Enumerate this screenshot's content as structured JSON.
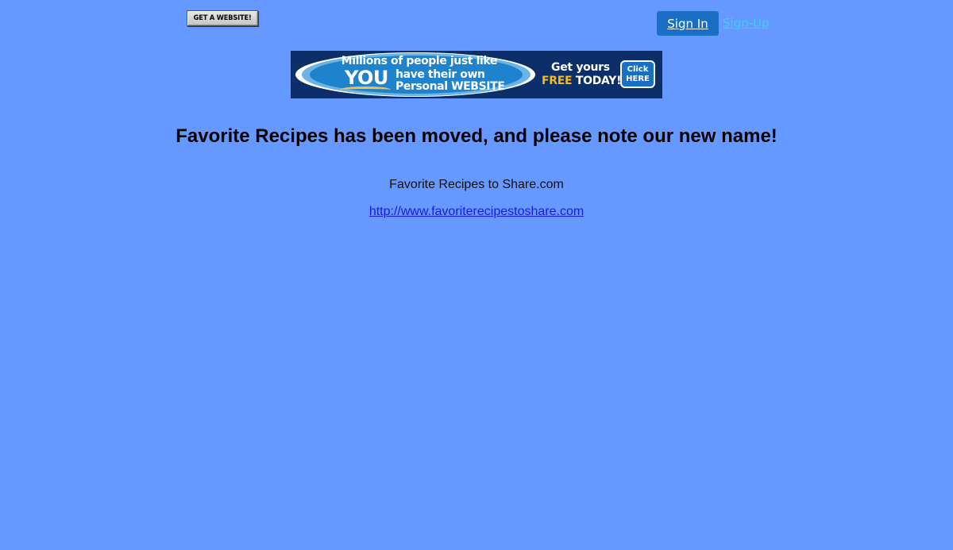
{
  "header": {
    "get_website_label": "GET A WEBSITE!",
    "sign_in_label": "Sign In",
    "sign_up_label": "Sign-Up"
  },
  "banner": {
    "line1": "Millions of people just like",
    "you": "YOU",
    "line2": "have their own",
    "line3": "Personal WEBSITE",
    "get_yours": "Get yours",
    "free": "FREE",
    "today": "TODAY!",
    "click": "Click",
    "here": "HERE"
  },
  "main": {
    "heading": "Favorite Recipes has been moved, and please note our new name!",
    "site_name": "Favorite Recipes to Share.com",
    "site_url": "http://www.favoriterecipestoshare.com"
  },
  "colors": {
    "page_background": "#6699ff",
    "sign_in_button": "#1a6fc4",
    "sign_up_link": "#38d0f0",
    "url_link": "#1a1ae6"
  }
}
